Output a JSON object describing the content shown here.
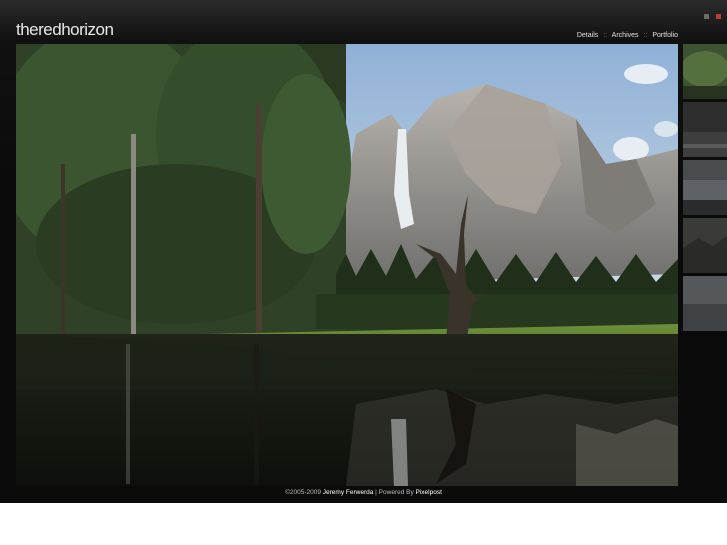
{
  "header": {
    "site_title": "theredhorizon",
    "nav": [
      {
        "label": "Details"
      },
      {
        "label": "Archives"
      },
      {
        "label": "Portfolio"
      }
    ],
    "nav_separator": "::"
  },
  "photo": {
    "subject": "Yosemite Falls reflected in meadow pond",
    "colors": {
      "sky": "#a9c3dc",
      "granite": "#9c9aa0",
      "forest": "#2c3f22",
      "water": "#141812",
      "meadow": "#5a7d2c"
    }
  },
  "thumbnails": [
    {
      "name": "thumb-1",
      "tone": "#3c5230"
    },
    {
      "name": "thumb-2",
      "tone": "#2e2e2e"
    },
    {
      "name": "thumb-3",
      "tone": "#494c4f"
    },
    {
      "name": "thumb-4",
      "tone": "#3a3a36"
    },
    {
      "name": "thumb-5",
      "tone": "#55585b"
    }
  ],
  "footer": {
    "copyright": "©2005-2009",
    "author": "Jeremy Ferwerda",
    "separator": "|",
    "powered_by": "Powered By",
    "engine": "Pixelpost"
  }
}
